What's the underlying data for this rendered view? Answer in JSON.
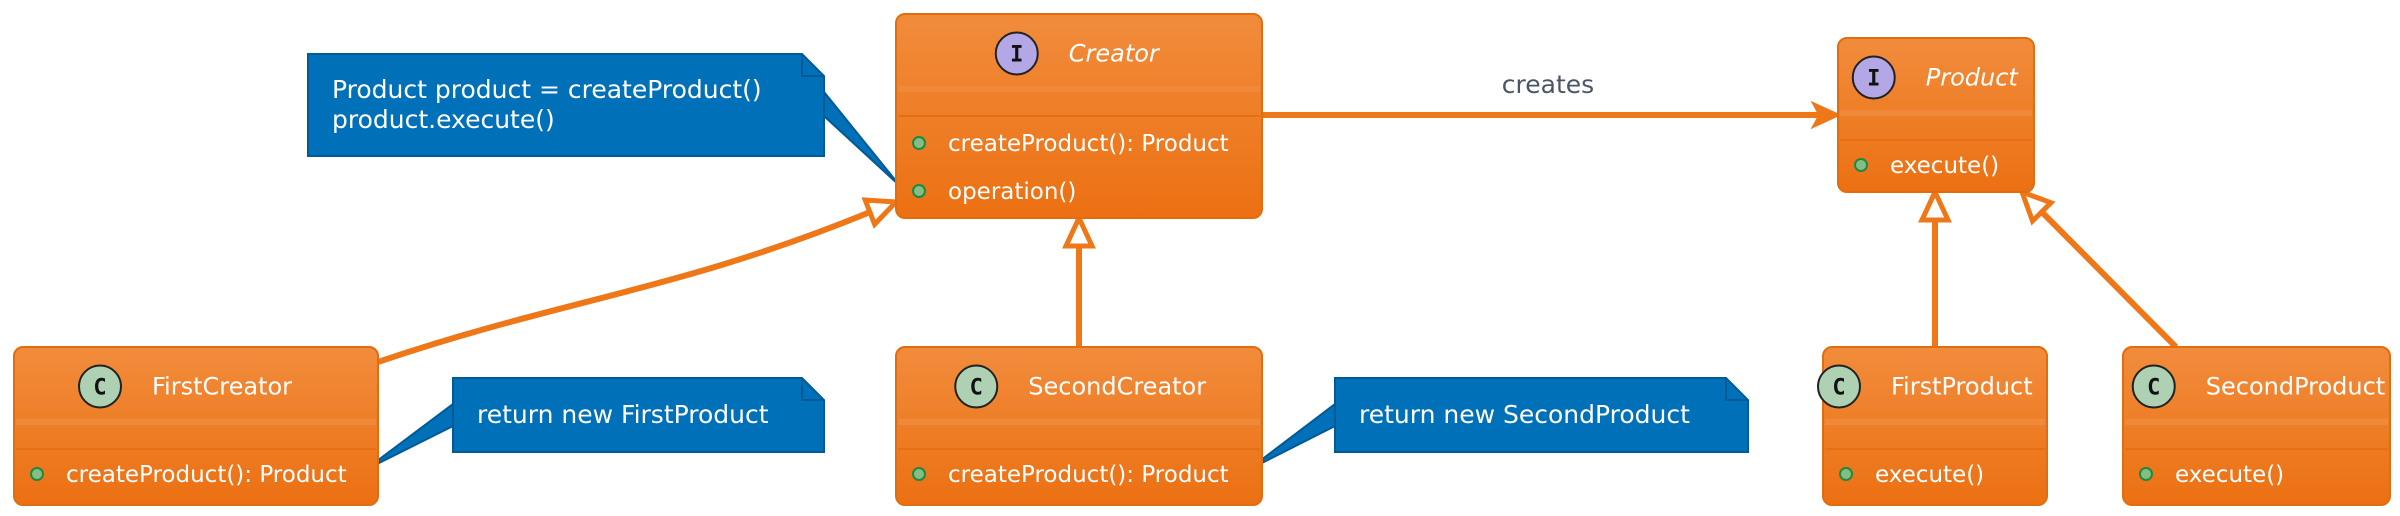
{
  "colors": {
    "box": "#ee7718",
    "box_top": "#f18c3c",
    "box_border": "#e06e10",
    "arrow": "#ee7718",
    "note": "#0070b8",
    "note_border": "#005a96",
    "interface_badge": "#b4a7e5",
    "class_badge": "#add1b2",
    "member_dot": "#84be84",
    "member_dot_border": "#1d8a40"
  },
  "classes": [
    {
      "id": "creator",
      "name": "Creator",
      "kind": "interface",
      "badge": "I",
      "italic": true,
      "members": [
        "createProduct(): Product",
        "operation()"
      ]
    },
    {
      "id": "product",
      "name": "Product",
      "kind": "interface",
      "badge": "I",
      "italic": true,
      "members": [
        "execute()"
      ]
    },
    {
      "id": "first-creator",
      "name": "FirstCreator",
      "kind": "class",
      "badge": "C",
      "italic": false,
      "members": [
        "createProduct(): Product"
      ]
    },
    {
      "id": "second-creator",
      "name": "SecondCreator",
      "kind": "class",
      "badge": "C",
      "italic": false,
      "members": [
        "createProduct(): Product"
      ]
    },
    {
      "id": "first-product",
      "name": "FirstProduct",
      "kind": "class",
      "badge": "C",
      "italic": false,
      "members": [
        "execute()"
      ]
    },
    {
      "id": "second-product",
      "name": "SecondProduct",
      "kind": "class",
      "badge": "C",
      "italic": false,
      "members": [
        "execute()"
      ]
    }
  ],
  "notes": [
    {
      "id": "creator-operation",
      "attached_to": "creator",
      "lines": [
        "Product product = createProduct()",
        "product.execute()"
      ]
    },
    {
      "id": "first-creator",
      "attached_to": "first-creator",
      "lines": [
        "return new FirstProduct"
      ]
    },
    {
      "id": "second-creator",
      "attached_to": "second-creator",
      "lines": [
        "return new SecondProduct"
      ]
    }
  ],
  "relations": [
    {
      "from": "creator",
      "to": "product",
      "type": "association",
      "label": "creates"
    },
    {
      "from": "first-creator",
      "to": "creator",
      "type": "generalization"
    },
    {
      "from": "second-creator",
      "to": "creator",
      "type": "generalization"
    },
    {
      "from": "first-product",
      "to": "product",
      "type": "generalization"
    },
    {
      "from": "second-product",
      "to": "product",
      "type": "generalization"
    }
  ]
}
